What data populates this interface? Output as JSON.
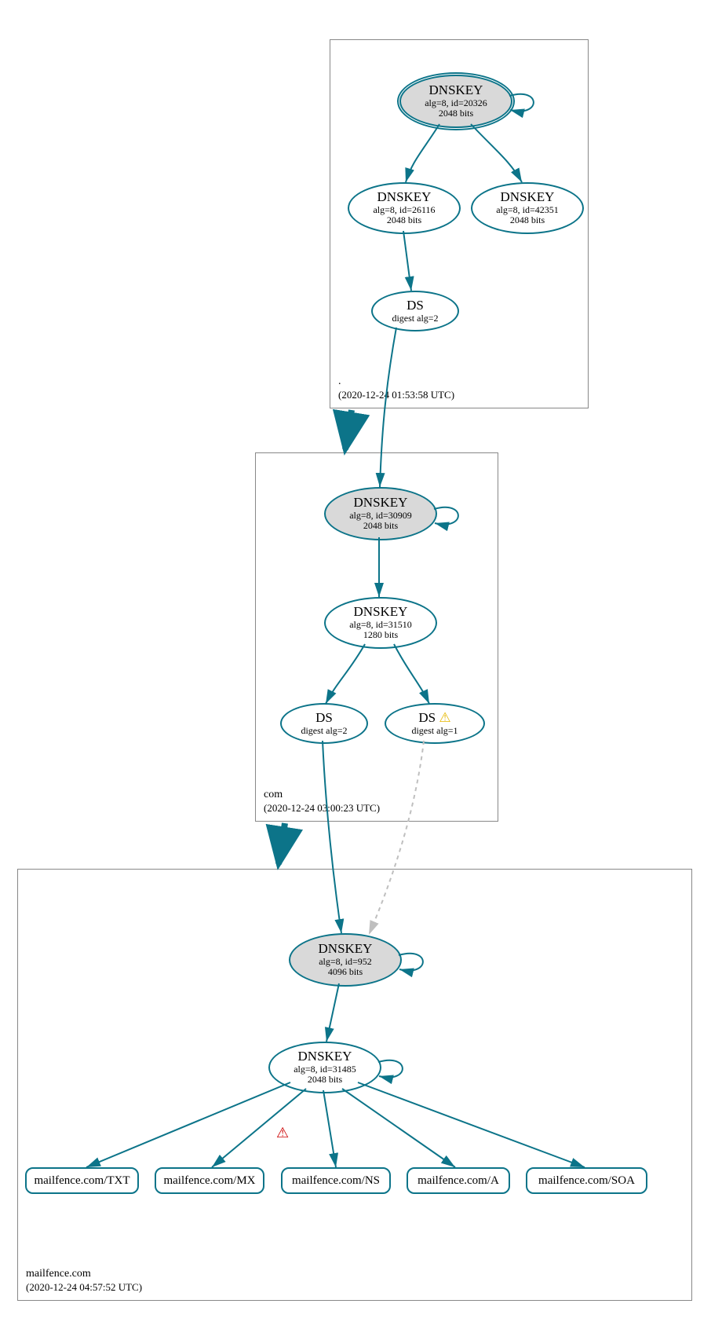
{
  "colors": {
    "edge": "#0c7489",
    "edge_insecure": "#bfbfbf"
  },
  "zones": {
    "root": {
      "name": ".",
      "ts": "(2020-12-24 01:53:58 UTC)"
    },
    "com": {
      "name": "com",
      "ts": "(2020-12-24 03:00:23 UTC)"
    },
    "mailfence": {
      "name": "mailfence.com",
      "ts": "(2020-12-24 04:57:52 UTC)"
    }
  },
  "nodes": {
    "root_ksk": {
      "title": "DNSKEY",
      "sub1": "alg=8, id=20326",
      "sub2": "2048 bits"
    },
    "root_zsk_26116": {
      "title": "DNSKEY",
      "sub1": "alg=8, id=26116",
      "sub2": "2048 bits"
    },
    "root_zsk_42351": {
      "title": "DNSKEY",
      "sub1": "alg=8, id=42351",
      "sub2": "2048 bits"
    },
    "root_ds": {
      "title": "DS",
      "sub1": "digest alg=2"
    },
    "com_ksk": {
      "title": "DNSKEY",
      "sub1": "alg=8, id=30909",
      "sub2": "2048 bits"
    },
    "com_zsk": {
      "title": "DNSKEY",
      "sub1": "alg=8, id=31510",
      "sub2": "1280 bits"
    },
    "com_ds2": {
      "title": "DS",
      "sub1": "digest alg=2"
    },
    "com_ds1": {
      "title": "DS",
      "sub1": "digest alg=1",
      "warn": "⚠"
    },
    "mf_ksk": {
      "title": "DNSKEY",
      "sub1": "alg=8, id=952",
      "sub2": "4096 bits"
    },
    "mf_zsk": {
      "title": "DNSKEY",
      "sub1": "alg=8, id=31485",
      "sub2": "2048 bits"
    }
  },
  "rrsets": {
    "txt": "mailfence.com/TXT",
    "mx": "mailfence.com/MX",
    "ns": "mailfence.com/NS",
    "a": "mailfence.com/A",
    "soa": "mailfence.com/SOA"
  },
  "warnings": {
    "ns_edge": "⚠"
  }
}
